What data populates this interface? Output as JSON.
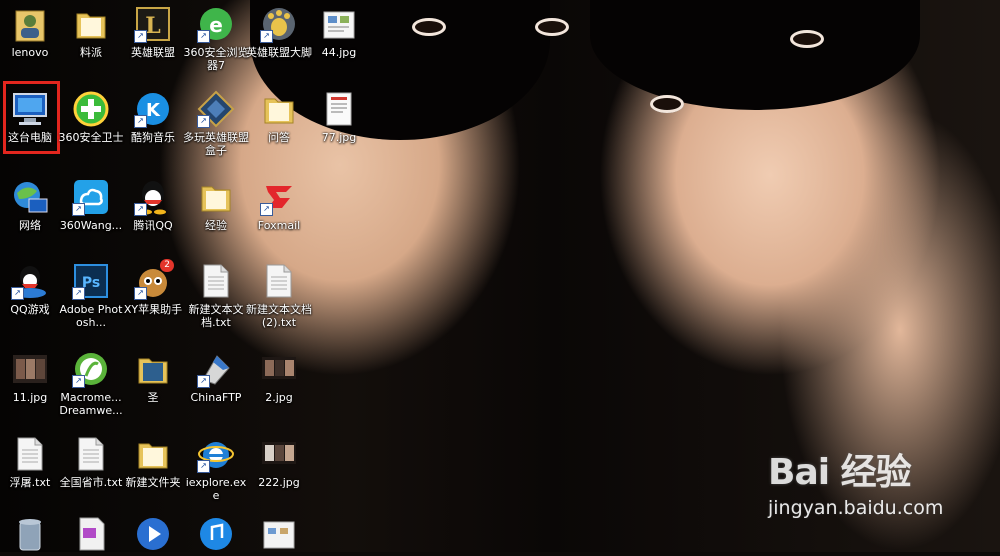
{
  "desktop": {
    "icons": [
      {
        "label": "lenovo",
        "icon": "user-folder-icon"
      },
      {
        "label": "这台电脑",
        "icon": "computer-icon"
      },
      {
        "label": "网络",
        "icon": "network-globe-icon"
      },
      {
        "label": "QQ游戏",
        "icon": "qq-game-icon"
      },
      {
        "label": "11.jpg",
        "icon": "image-thumb-icon"
      },
      {
        "label": "浮屠.txt",
        "icon": "text-file-icon"
      },
      {
        "label": "",
        "icon": "recycle-bin-icon"
      },
      {
        "label": "料派",
        "icon": "folder-icon"
      },
      {
        "label": "360安全卫士",
        "icon": "360-guard-icon"
      },
      {
        "label": "360Wang...",
        "icon": "cloud-drive-icon"
      },
      {
        "label": "Adobe Photosh...",
        "icon": "photoshop-icon"
      },
      {
        "label": "Macrome... Dreamwe...",
        "icon": "dreamweaver-icon"
      },
      {
        "label": "全国省市.txt",
        "icon": "text-file-icon"
      },
      {
        "label": "",
        "icon": "document-icon"
      },
      {
        "label": "英雄联盟",
        "icon": "lol-icon"
      },
      {
        "label": "酷狗音乐",
        "icon": "kugou-icon"
      },
      {
        "label": "腾讯QQ",
        "icon": "qq-penguin-icon"
      },
      {
        "label": "XY苹果助手",
        "icon": "xy-assistant-icon"
      },
      {
        "label": "圣",
        "icon": "folder-icon"
      },
      {
        "label": "新建文件夹",
        "icon": "folder-icon"
      },
      {
        "label": "",
        "icon": "media-player-icon"
      },
      {
        "label": "360安全浏览器7",
        "icon": "360-browser-icon"
      },
      {
        "label": "多玩英雄联盟盒子",
        "icon": "duowan-box-icon"
      },
      {
        "label": "经验",
        "icon": "folder-icon"
      },
      {
        "label": "新建文本文档.txt",
        "icon": "text-file-icon"
      },
      {
        "label": "ChinaFTP",
        "icon": "ftp-icon"
      },
      {
        "label": "iexplore.exe",
        "icon": "ie-icon"
      },
      {
        "label": "",
        "icon": "itunes-icon"
      },
      {
        "label": "英雄联盟大脚",
        "icon": "bigfoot-icon"
      },
      {
        "label": "问答",
        "icon": "folder-icon"
      },
      {
        "label": "Foxmail",
        "icon": "foxmail-icon"
      },
      {
        "label": "新建文本文档 (2).txt",
        "icon": "text-file-icon"
      },
      {
        "label": "2.jpg",
        "icon": "image-thumb-icon"
      },
      {
        "label": "222.jpg",
        "icon": "image-thumb-icon"
      },
      {
        "label": "",
        "icon": "image-thumb-icon"
      },
      {
        "label": "44.jpg",
        "icon": "image-thumb-icon"
      },
      {
        "label": "77.jpg",
        "icon": "image-thumb-icon"
      }
    ],
    "badge_count": "2"
  },
  "watermark": {
    "logo": "Bai 经验",
    "url": "jingyan.baidu.com"
  },
  "colors": {
    "selection": "#e2261e",
    "label": "#ffffff"
  }
}
